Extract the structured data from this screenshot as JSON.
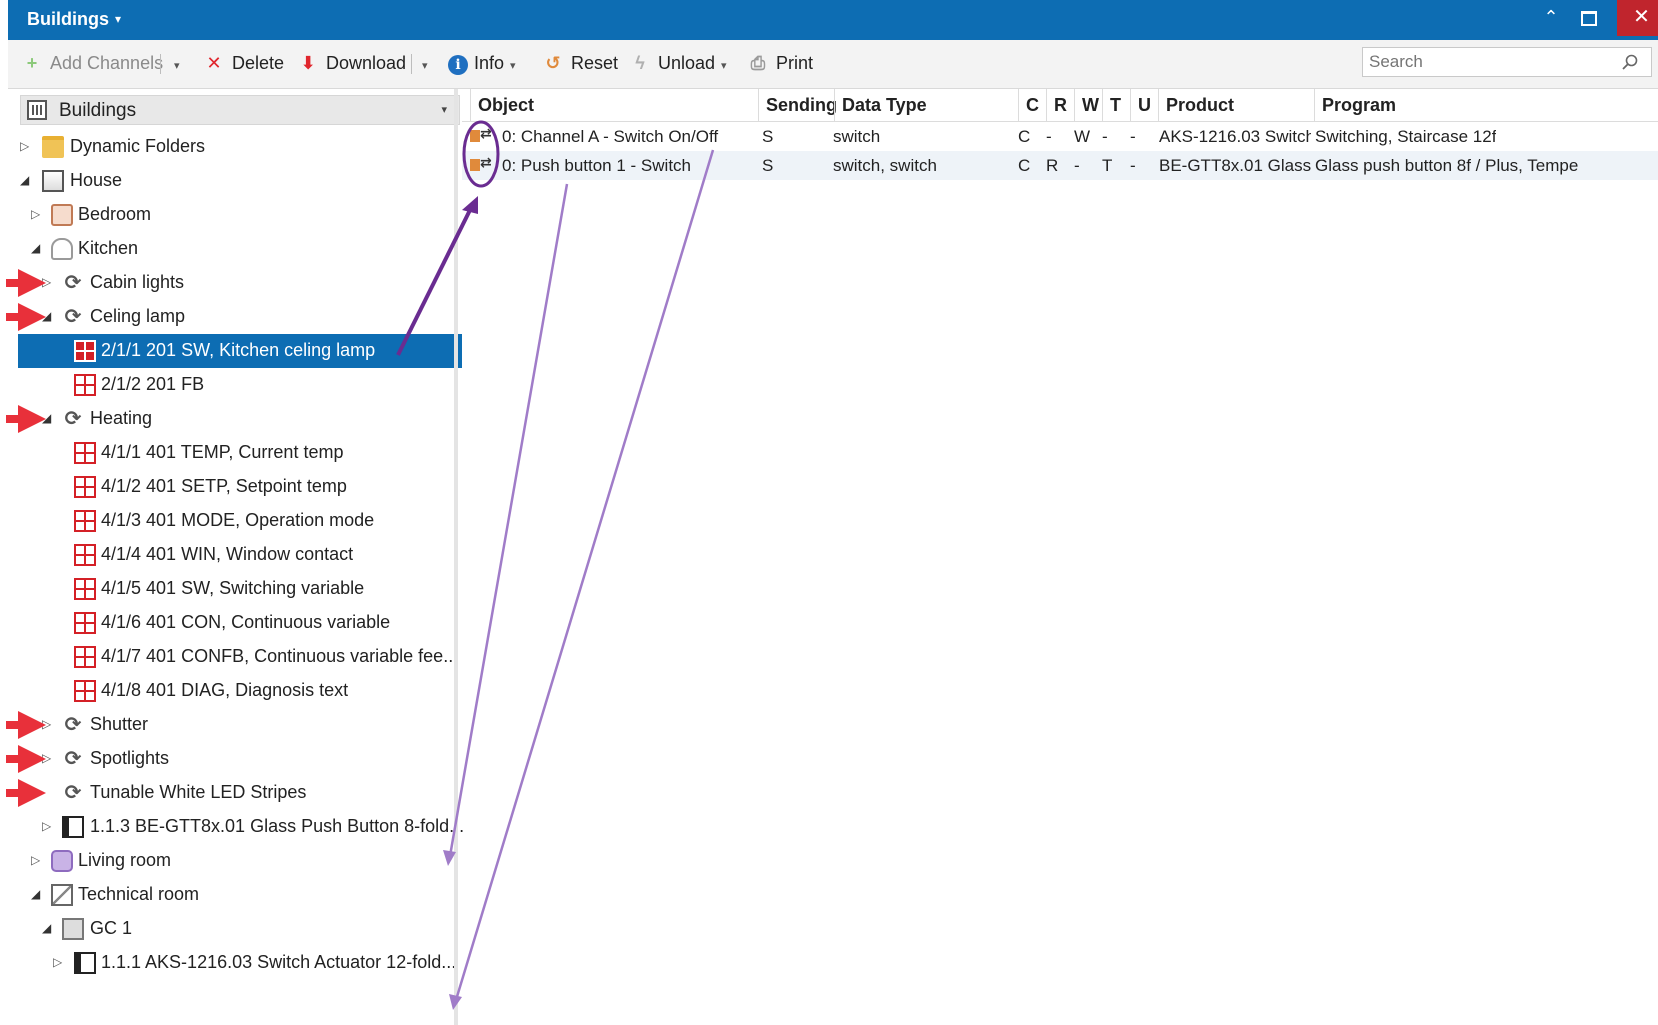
{
  "window": {
    "title": "Buildings",
    "caret": "▾",
    "minimize": "⌃",
    "close": "✕"
  },
  "toolbar": {
    "add_channels": "Add Channels",
    "delete": "Delete",
    "download": "Download",
    "info": "Info",
    "reset": "Reset",
    "unload": "Unload",
    "print": "Print",
    "search_placeholder": "Search",
    "icons": {
      "add": "+",
      "delete": "✕",
      "download": "⬇",
      "info": "i",
      "reset": "↺",
      "unload": "ϟ",
      "print": "⎙",
      "dropdown": "▾"
    }
  },
  "tree": {
    "header": "Buildings",
    "items": [
      {
        "label": "Dynamic Folders",
        "icon": "folder-icon"
      },
      {
        "label": "House",
        "icon": "house-icon"
      },
      {
        "label": "Bedroom",
        "icon": "bed-icon"
      },
      {
        "label": "Kitchen",
        "icon": "chef-hat-icon"
      },
      {
        "label": "Cabin lights",
        "icon": "function-icon"
      },
      {
        "label": "Celing lamp",
        "icon": "function-icon"
      },
      {
        "label": "2/1/1 201 SW, Kitchen celing lamp",
        "icon": "group-address-icon",
        "selected": true
      },
      {
        "label": "2/1/2 201 FB",
        "icon": "group-address-icon"
      },
      {
        "label": "Heating",
        "icon": "function-icon"
      },
      {
        "label": "4/1/1 401 TEMP, Current temp",
        "icon": "group-address-icon"
      },
      {
        "label": "4/1/2 401 SETP, Setpoint temp",
        "icon": "group-address-icon"
      },
      {
        "label": "4/1/3 401 MODE, Operation mode",
        "icon": "group-address-icon"
      },
      {
        "label": "4/1/4 401 WIN, Window contact",
        "icon": "group-address-icon"
      },
      {
        "label": "4/1/5 401 SW, Switching variable",
        "icon": "group-address-icon"
      },
      {
        "label": "4/1/6 401 CON, Continuous variable",
        "icon": "group-address-icon"
      },
      {
        "label": "4/1/7 401 CONFB, Continuous variable fee...",
        "icon": "group-address-icon"
      },
      {
        "label": "4/1/8 401 DIAG, Diagnosis text",
        "icon": "group-address-icon"
      },
      {
        "label": "Shutter",
        "icon": "function-icon"
      },
      {
        "label": "Spotlights",
        "icon": "function-icon"
      },
      {
        "label": "Tunable White LED Stripes",
        "icon": "function-icon"
      },
      {
        "label": "1.1.3 BE-GTT8x.01 Glass Push Button 8-fold...",
        "icon": "device-icon"
      },
      {
        "label": "Living room",
        "icon": "sofa-icon"
      },
      {
        "label": "Technical room",
        "icon": "technical-room-icon"
      },
      {
        "label": "GC 1",
        "icon": "cabinet-icon"
      },
      {
        "label": "1.1.1 AKS-1216.03 Switch Actuator 12-fold...",
        "icon": "device-icon"
      }
    ]
  },
  "grid": {
    "columns": [
      "Object",
      "Sending",
      "Data Type",
      "C",
      "R",
      "W",
      "T",
      "U",
      "Product",
      "Program"
    ],
    "rows": [
      {
        "object": "0: Channel A - Switch On/Off",
        "sending": "S",
        "datatype": "switch",
        "c": "C",
        "r": "-",
        "w": "W",
        "t": "-",
        "u": "-",
        "product": "AKS-1216.03 Switch...",
        "program": "Switching, Staircase 12f"
      },
      {
        "object": "0: Push button 1 - Switch",
        "sending": "S",
        "datatype": "switch, switch",
        "c": "C",
        "r": "R",
        "w": "-",
        "t": "T",
        "u": "-",
        "product": "BE-GTT8x.01 Glass...",
        "program": "Glass push button 8f / Plus, Tempe"
      }
    ]
  },
  "colors": {
    "titlebar": "#0d6db3",
    "selection": "#0d6db3",
    "close": "#c0252d",
    "annotation_red": "#e8303a",
    "annotation_purple": "#6a2c91",
    "annotation_lilac": "#a07cc8"
  }
}
